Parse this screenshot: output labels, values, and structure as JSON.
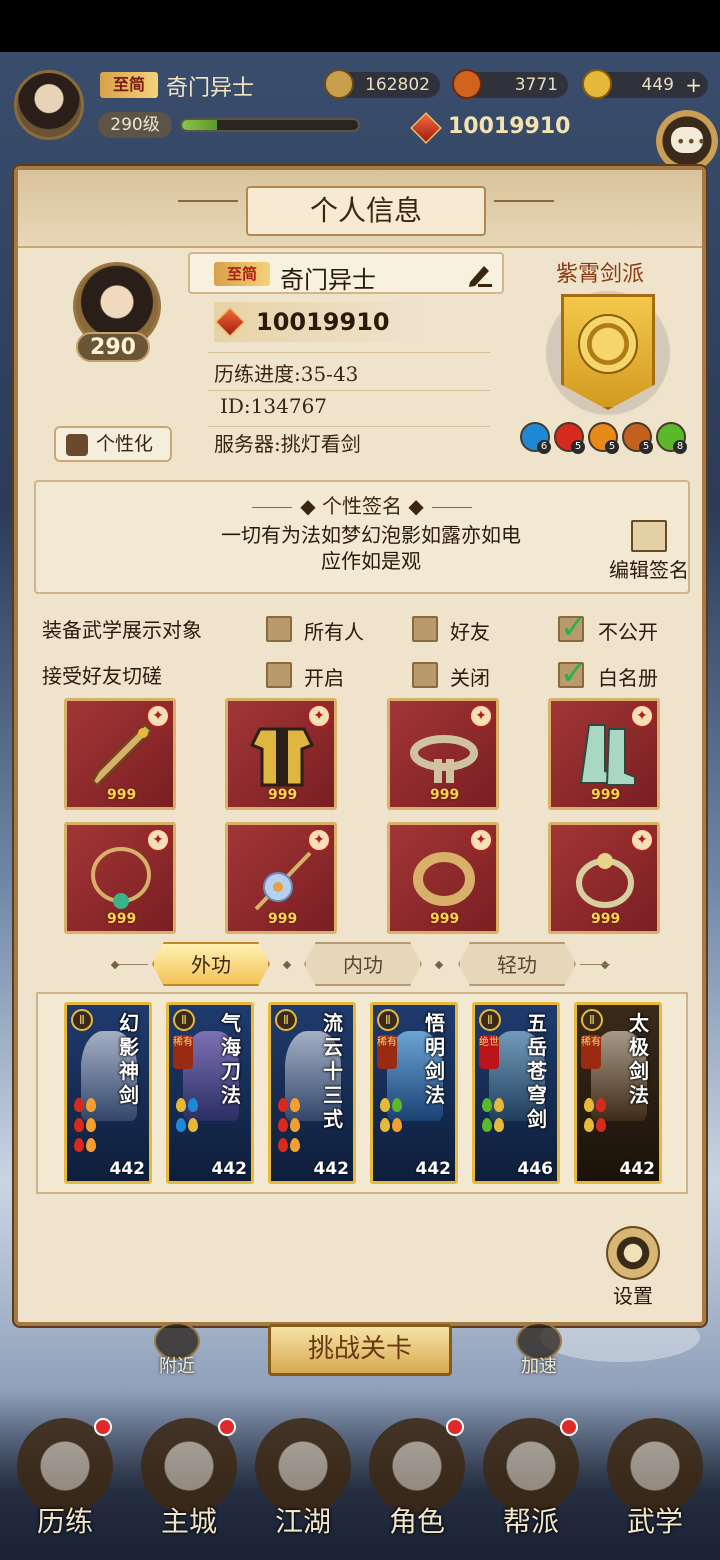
{
  "player": {
    "title_badge": "至简",
    "name": "奇门异士",
    "level_label": "290级",
    "exp_fraction": 0.2,
    "power": "10019910"
  },
  "resources": [
    {
      "icon": "copper-coin-icon",
      "value": "162802",
      "color": "#c9a04a"
    },
    {
      "icon": "stamina-icon",
      "value": "3771",
      "color": "#d0641e"
    },
    {
      "icon": "gold-ingot-icon",
      "value": "449",
      "color": "#e6b93a"
    }
  ],
  "panel": {
    "title": "个人信息",
    "avatar_level": "290",
    "customize_label": "个性化",
    "name_badge": "至简",
    "name": "奇门异士",
    "power": "10019910",
    "progress": "历练进度:35-43",
    "id": "ID:134767",
    "server": "服务器:挑灯看剑",
    "sect_name": "紫霄剑派",
    "elements": [
      {
        "icon": "water-element-icon",
        "count": "6",
        "color": "#1e8ad6"
      },
      {
        "icon": "fire-element-icon",
        "count": "5",
        "color": "#d62a1e"
      },
      {
        "icon": "sun-element-icon",
        "count": "5",
        "color": "#e68a1a"
      },
      {
        "icon": "earth-element-icon",
        "count": "5",
        "color": "#c2621e"
      },
      {
        "icon": "wood-element-icon",
        "count": "8",
        "color": "#5ab82a"
      }
    ]
  },
  "signature": {
    "title": "个性签名",
    "text_line1": "一切有为法如梦幻泡影如露亦如电",
    "text_line2": "应作如是观",
    "edit_label": "编辑签名"
  },
  "options": {
    "display_label": "装备武学展示对象",
    "display_choices": [
      {
        "label": "所有人",
        "checked": false
      },
      {
        "label": "好友",
        "checked": false
      },
      {
        "label": "不公开",
        "checked": true
      }
    ],
    "spar_label": "接受好友切磋",
    "spar_choices": [
      {
        "label": "开启",
        "checked": false
      },
      {
        "label": "关闭",
        "checked": false
      },
      {
        "label": "白名册",
        "checked": true
      }
    ]
  },
  "equipment": [
    {
      "name": "sword",
      "count": "999"
    },
    {
      "name": "armor",
      "count": "999"
    },
    {
      "name": "belt",
      "count": "999"
    },
    {
      "name": "boots",
      "count": "999"
    },
    {
      "name": "necklace",
      "count": "999"
    },
    {
      "name": "hairpin",
      "count": "999"
    },
    {
      "name": "bracelet",
      "count": "999"
    },
    {
      "name": "ring",
      "count": "999"
    }
  ],
  "tabs": [
    "外功",
    "内功",
    "轻功"
  ],
  "active_tab": "外功",
  "skills": [
    {
      "name": "幻影神剑",
      "level": "442",
      "rarity": ""
    },
    {
      "name": "气海刀法",
      "level": "442",
      "rarity": "稀有"
    },
    {
      "name": "流云十三式",
      "level": "442",
      "rarity": ""
    },
    {
      "name": "悟明剑法",
      "level": "442",
      "rarity": "稀有"
    },
    {
      "name": "五岳苍穹剑",
      "level": "446",
      "rarity": "绝世"
    },
    {
      "name": "太极剑法",
      "level": "442",
      "rarity": "稀有"
    }
  ],
  "settings_label": "设置",
  "bottom": {
    "challenge_label": "挑战关卡",
    "nearby_label": "附近",
    "speed_label": "加速"
  },
  "nav": [
    "历练",
    "主城",
    "江湖",
    "角色",
    "帮派",
    "武学"
  ]
}
